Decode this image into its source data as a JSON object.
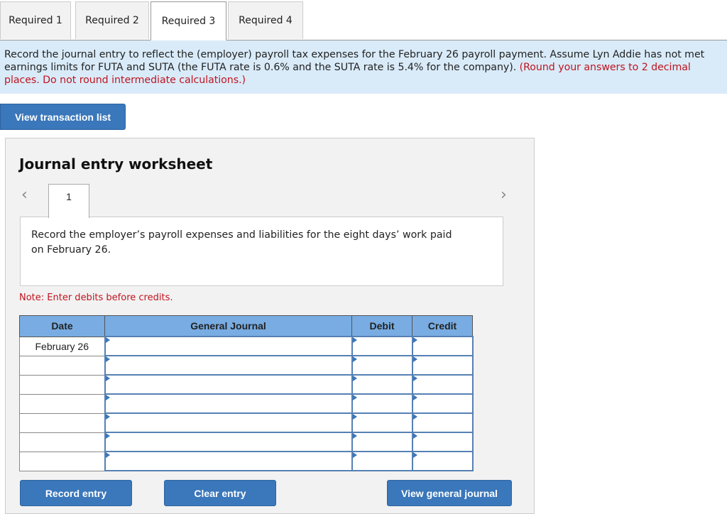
{
  "tabs": [
    {
      "label": "Required 1",
      "active": false
    },
    {
      "label": "Required 2",
      "active": false
    },
    {
      "label": "Required 3",
      "active": true
    },
    {
      "label": "Required 4",
      "active": false
    }
  ],
  "instructions": {
    "text": "Record the journal entry to reflect the (employer) payroll tax expenses for the February 26 payroll payment. Assume Lyn Addie has not met earnings limits for FUTA and SUTA (the FUTA rate is 0.6% and the SUTA rate is 5.4% for the company). ",
    "note_red": "(Round your answers to 2 decimal places. Do not round intermediate calculations.)"
  },
  "view_transaction_list_label": "View transaction list",
  "worksheet": {
    "title": "Journal entry worksheet",
    "prev_icon": "chevron-left-icon",
    "next_icon": "chevron-right-icon",
    "entry_tab": "1",
    "description": "Record the employer’s payroll expenses and liabilities for the eight days’ work paid on February 26.",
    "note": "Note: Enter debits before credits.",
    "table": {
      "headers": {
        "date": "Date",
        "journal": "General Journal",
        "debit": "Debit",
        "credit": "Credit"
      },
      "rows": [
        {
          "date": "February 26",
          "account": "",
          "debit": "",
          "credit": ""
        },
        {
          "date": "",
          "account": "",
          "debit": "",
          "credit": ""
        },
        {
          "date": "",
          "account": "",
          "debit": "",
          "credit": ""
        },
        {
          "date": "",
          "account": "",
          "debit": "",
          "credit": ""
        },
        {
          "date": "",
          "account": "",
          "debit": "",
          "credit": ""
        },
        {
          "date": "",
          "account": "",
          "debit": "",
          "credit": ""
        },
        {
          "date": "",
          "account": "",
          "debit": "",
          "credit": ""
        }
      ]
    },
    "buttons": {
      "record": "Record entry",
      "clear": "Clear entry",
      "view_journal": "View general journal"
    }
  }
}
